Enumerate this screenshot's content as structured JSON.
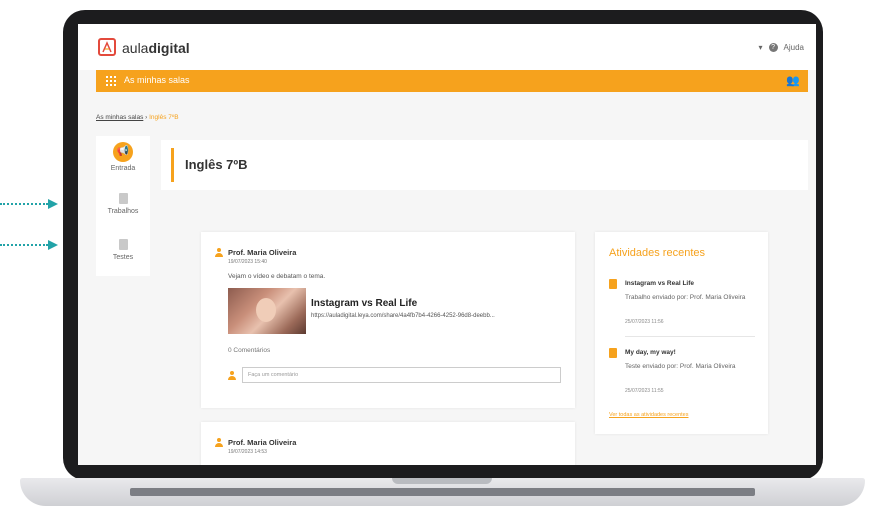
{
  "header": {
    "logo_text_strong": "aula",
    "logo_text_rest": "digital",
    "help_label": "Ajuda"
  },
  "orange_bar": {
    "label": "As minhas salas"
  },
  "breadcrumb": {
    "link": "As minhas salas",
    "separator": "›",
    "current": "Inglês 7ºB"
  },
  "left_nav": {
    "items": [
      {
        "label": "Entrada",
        "icon": "megaphone-icon"
      },
      {
        "label": "Trabalhos",
        "icon": "document-icon"
      },
      {
        "label": "Testes",
        "icon": "document-icon"
      }
    ]
  },
  "page": {
    "title": "Inglês 7ºB"
  },
  "posts": [
    {
      "author": "Prof. Maria Oliveira",
      "date": "19/07/2023 15:40",
      "text": "Vejam o vídeo e debatam o tema.",
      "media_title": "Instagram vs Real Life",
      "media_url": "https://auladigital.leya.com/share/4a4fb7b4-4266-4252-96d8-deebb...",
      "comments": "0 Comentários",
      "comment_placeholder": "Faça um comentário"
    },
    {
      "author": "Prof. Maria Oliveira",
      "date": "19/07/2023 14:53"
    }
  ],
  "recent": {
    "title": "Atividades recentes",
    "items": [
      {
        "title": "Instagram vs Real Life",
        "desc": "Trabalho enviado por: Prof. Maria Oliveira",
        "date": "25/07/2023 11:56"
      },
      {
        "title": "My day, my way!",
        "desc": "Teste enviado por: Prof. Maria Oliveira",
        "date": "25/07/2023 11:55"
      }
    ],
    "see_all": "Ver todas as atividades recentes"
  },
  "colors": {
    "accent": "#f6a21d",
    "arrow": "#22a3a8",
    "logo": "#e34a3c"
  }
}
